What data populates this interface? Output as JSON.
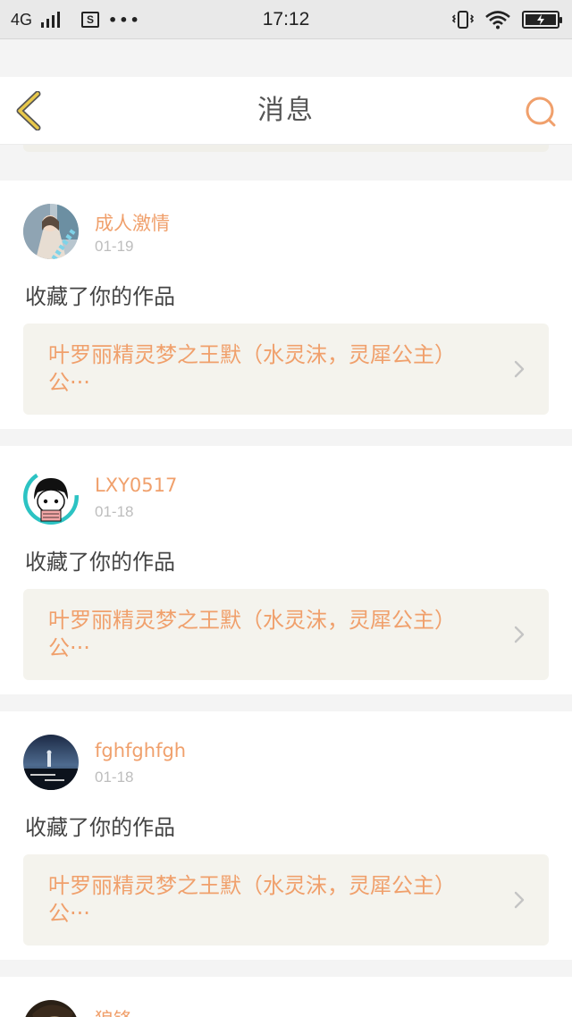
{
  "status_bar": {
    "network": "4G",
    "sim_label": "S",
    "more": "•••",
    "time": "17:12"
  },
  "header": {
    "title": "消息",
    "back_icon": "chevron-left-icon",
    "search_icon": "search-icon"
  },
  "colors": {
    "accent": "#f0a06c",
    "back_icon": "#e8c84a",
    "card_box": "#f4f3ed",
    "background": "#f4f4f4"
  },
  "messages": [
    {
      "username": "成人激情",
      "date": "01-19",
      "action": "收藏了你的作品",
      "work_title": "叶罗丽精灵梦之王默（水灵沫，灵犀公主）公···"
    },
    {
      "username": "LXY0517",
      "date": "01-18",
      "action": "收藏了你的作品",
      "work_title": "叶罗丽精灵梦之王默（水灵沫，灵犀公主）公···"
    },
    {
      "username": "fghfghfgh",
      "date": "01-18",
      "action": "收藏了你的作品",
      "work_title": "叶罗丽精灵梦之王默（水灵沫，灵犀公主）公···"
    },
    {
      "username": "狼锋",
      "date": "",
      "action": "",
      "work_title": ""
    }
  ]
}
